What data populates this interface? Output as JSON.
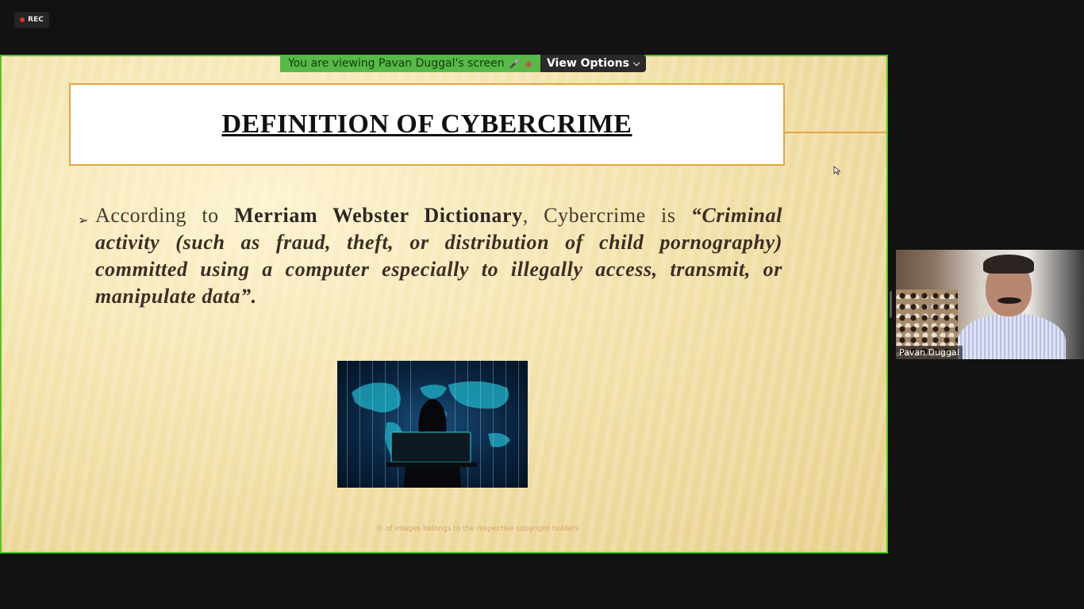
{
  "recording": {
    "label": "REC"
  },
  "share_banner": {
    "status_text": "You are viewing Pavan Duggal's screen",
    "options_label": "View Options"
  },
  "slide": {
    "title": "DEFINITION OF CYBERCRIME",
    "bullet": {
      "intro": "According to",
      "source": "Merriam Webster Dictionary",
      "middle": ", Cybercrime is",
      "quote": "“Criminal activity (such as fraud, theft, or distribution of child pornography) committed using a computer especially to illegally access, transmit, or manipulate data”."
    },
    "footer": "© of images belongs to the respective copyright holders"
  },
  "participant": {
    "name": "Pavan Duggal"
  },
  "colors": {
    "share_border": "#4fc81f",
    "banner_green": "#57b947",
    "title_border": "#e2a647"
  }
}
